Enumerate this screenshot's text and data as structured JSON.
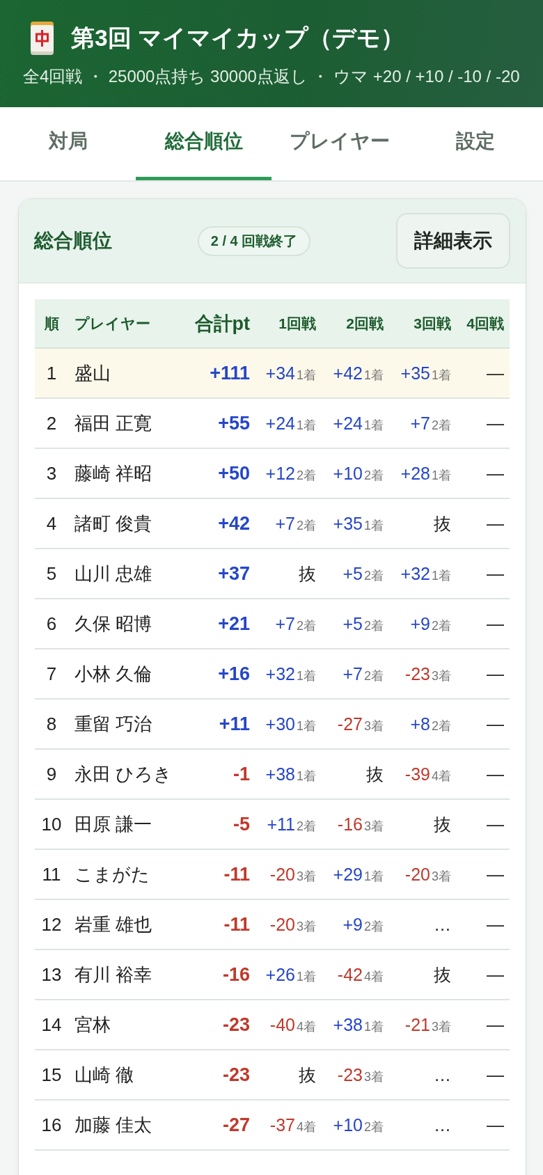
{
  "header": {
    "title": "第3回 マイマイカップ（デモ）",
    "subtitle": "全4回戦 ・ 25000点持ち 30000点返し ・ ウマ +20 / +10 / -10 / -20"
  },
  "tabs": [
    {
      "label": "対局",
      "selected": false
    },
    {
      "label": "総合順位",
      "selected": true
    },
    {
      "label": "プレイヤー",
      "selected": false
    },
    {
      "label": "設定",
      "selected": false
    }
  ],
  "standings": {
    "title": "総合順位",
    "progress": "2 / 4 回戦終了",
    "detail_button": "詳細表示",
    "columns": [
      "順",
      "プレイヤー",
      "合計pt",
      "1回戦",
      "2回戦",
      "3回戦",
      "4回戦"
    ],
    "rows": [
      {
        "rank": "1",
        "name": "盛山",
        "highlighted": true,
        "total": {
          "kind": "gain",
          "value": "+111"
        },
        "rounds": [
          {
            "kind": "gain",
            "value": "+34",
            "place": "1着"
          },
          {
            "kind": "gain",
            "value": "+42",
            "place": "1着"
          },
          {
            "kind": "gain",
            "value": "+35",
            "place": "1着"
          },
          {
            "kind": "mark",
            "value": "—"
          }
        ]
      },
      {
        "rank": "2",
        "name": "福田 正寛",
        "highlighted": false,
        "total": {
          "kind": "gain",
          "value": "+55"
        },
        "rounds": [
          {
            "kind": "gain",
            "value": "+24",
            "place": "1着"
          },
          {
            "kind": "gain",
            "value": "+24",
            "place": "1着"
          },
          {
            "kind": "gain",
            "value": "+7",
            "place": "2着"
          },
          {
            "kind": "mark",
            "value": "—"
          }
        ]
      },
      {
        "rank": "3",
        "name": "藤崎 祥昭",
        "highlighted": false,
        "total": {
          "kind": "gain",
          "value": "+50"
        },
        "rounds": [
          {
            "kind": "gain",
            "value": "+12",
            "place": "2着"
          },
          {
            "kind": "gain",
            "value": "+10",
            "place": "2着"
          },
          {
            "kind": "gain",
            "value": "+28",
            "place": "1着"
          },
          {
            "kind": "mark",
            "value": "—"
          }
        ]
      },
      {
        "rank": "4",
        "name": "諸町 俊貴",
        "highlighted": false,
        "total": {
          "kind": "gain",
          "value": "+42"
        },
        "rounds": [
          {
            "kind": "gain",
            "value": "+7",
            "place": "2着"
          },
          {
            "kind": "gain",
            "value": "+35",
            "place": "1着"
          },
          {
            "kind": "mark",
            "value": "抜"
          },
          {
            "kind": "mark",
            "value": "—"
          }
        ]
      },
      {
        "rank": "5",
        "name": "山川 忠雄",
        "highlighted": false,
        "total": {
          "kind": "gain",
          "value": "+37"
        },
        "rounds": [
          {
            "kind": "mark",
            "value": "抜"
          },
          {
            "kind": "gain",
            "value": "+5",
            "place": "2着"
          },
          {
            "kind": "gain",
            "value": "+32",
            "place": "1着"
          },
          {
            "kind": "mark",
            "value": "—"
          }
        ]
      },
      {
        "rank": "6",
        "name": "久保 昭博",
        "highlighted": false,
        "total": {
          "kind": "gain",
          "value": "+21"
        },
        "rounds": [
          {
            "kind": "gain",
            "value": "+7",
            "place": "2着"
          },
          {
            "kind": "gain",
            "value": "+5",
            "place": "2着"
          },
          {
            "kind": "gain",
            "value": "+9",
            "place": "2着"
          },
          {
            "kind": "mark",
            "value": "—"
          }
        ]
      },
      {
        "rank": "7",
        "name": "小林 久倫",
        "highlighted": false,
        "total": {
          "kind": "gain",
          "value": "+16"
        },
        "rounds": [
          {
            "kind": "gain",
            "value": "+32",
            "place": "1着"
          },
          {
            "kind": "gain",
            "value": "+7",
            "place": "2着"
          },
          {
            "kind": "loss",
            "value": "-23",
            "place": "3着"
          },
          {
            "kind": "mark",
            "value": "—"
          }
        ]
      },
      {
        "rank": "8",
        "name": "重留 巧治",
        "highlighted": false,
        "total": {
          "kind": "gain",
          "value": "+11"
        },
        "rounds": [
          {
            "kind": "gain",
            "value": "+30",
            "place": "1着"
          },
          {
            "kind": "loss",
            "value": "-27",
            "place": "3着"
          },
          {
            "kind": "gain",
            "value": "+8",
            "place": "2着"
          },
          {
            "kind": "mark",
            "value": "—"
          }
        ]
      },
      {
        "rank": "9",
        "name": "永田 ひろき",
        "highlighted": false,
        "total": {
          "kind": "loss",
          "value": "-1"
        },
        "rounds": [
          {
            "kind": "gain",
            "value": "+38",
            "place": "1着"
          },
          {
            "kind": "mark",
            "value": "抜"
          },
          {
            "kind": "loss",
            "value": "-39",
            "place": "4着"
          },
          {
            "kind": "mark",
            "value": "—"
          }
        ]
      },
      {
        "rank": "10",
        "name": "田原 謙一",
        "highlighted": false,
        "total": {
          "kind": "loss",
          "value": "-5"
        },
        "rounds": [
          {
            "kind": "gain",
            "value": "+11",
            "place": "2着"
          },
          {
            "kind": "loss",
            "value": "-16",
            "place": "3着"
          },
          {
            "kind": "mark",
            "value": "抜"
          },
          {
            "kind": "mark",
            "value": "—"
          }
        ]
      },
      {
        "rank": "11",
        "name": "こまがた",
        "highlighted": false,
        "total": {
          "kind": "loss",
          "value": "-11"
        },
        "rounds": [
          {
            "kind": "loss",
            "value": "-20",
            "place": "3着"
          },
          {
            "kind": "gain",
            "value": "+29",
            "place": "1着"
          },
          {
            "kind": "loss",
            "value": "-20",
            "place": "3着"
          },
          {
            "kind": "mark",
            "value": "—"
          }
        ]
      },
      {
        "rank": "12",
        "name": "岩重 雄也",
        "highlighted": false,
        "total": {
          "kind": "loss",
          "value": "-11"
        },
        "rounds": [
          {
            "kind": "loss",
            "value": "-20",
            "place": "3着"
          },
          {
            "kind": "gain",
            "value": "+9",
            "place": "2着"
          },
          {
            "kind": "mark",
            "value": "…"
          },
          {
            "kind": "mark",
            "value": "—"
          }
        ]
      },
      {
        "rank": "13",
        "name": "有川 裕幸",
        "highlighted": false,
        "total": {
          "kind": "loss",
          "value": "-16"
        },
        "rounds": [
          {
            "kind": "gain",
            "value": "+26",
            "place": "1着"
          },
          {
            "kind": "loss",
            "value": "-42",
            "place": "4着"
          },
          {
            "kind": "mark",
            "value": "抜"
          },
          {
            "kind": "mark",
            "value": "—"
          }
        ]
      },
      {
        "rank": "14",
        "name": "宮林",
        "highlighted": false,
        "total": {
          "kind": "loss",
          "value": "-23"
        },
        "rounds": [
          {
            "kind": "loss",
            "value": "-40",
            "place": "4着"
          },
          {
            "kind": "gain",
            "value": "+38",
            "place": "1着"
          },
          {
            "kind": "loss",
            "value": "-21",
            "place": "3着"
          },
          {
            "kind": "mark",
            "value": "—"
          }
        ]
      },
      {
        "rank": "15",
        "name": "山崎 徹",
        "highlighted": false,
        "total": {
          "kind": "loss",
          "value": "-23"
        },
        "rounds": [
          {
            "kind": "mark",
            "value": "抜"
          },
          {
            "kind": "loss",
            "value": "-23",
            "place": "3着"
          },
          {
            "kind": "mark",
            "value": "…"
          },
          {
            "kind": "mark",
            "value": "—"
          }
        ]
      },
      {
        "rank": "16",
        "name": "加藤 佳太",
        "highlighted": false,
        "total": {
          "kind": "loss",
          "value": "-27"
        },
        "rounds": [
          {
            "kind": "loss",
            "value": "-37",
            "place": "4着"
          },
          {
            "kind": "gain",
            "value": "+10",
            "place": "2着"
          },
          {
            "kind": "mark",
            "value": "…"
          },
          {
            "kind": "mark",
            "value": "—"
          }
        ]
      }
    ]
  }
}
